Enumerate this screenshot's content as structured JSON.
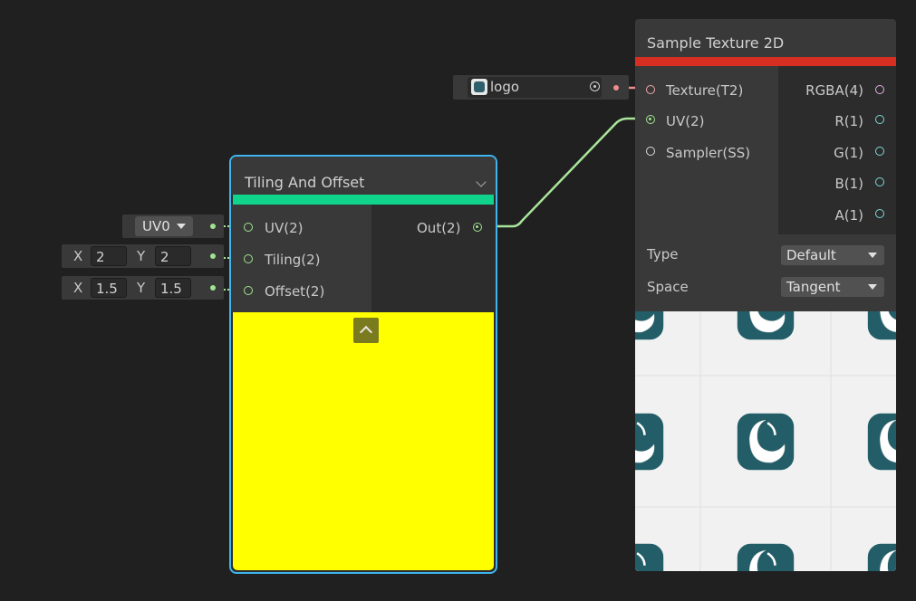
{
  "tiling_node": {
    "title": "Tiling And Offset",
    "inputs": [
      "UV(2)",
      "Tiling(2)",
      "Offset(2)"
    ],
    "output": "Out(2)",
    "accent_color": "#10d38c",
    "preview_color": "#ffff00"
  },
  "uv_field": {
    "value": "UV0"
  },
  "tiling_field": {
    "x_label": "X",
    "x_value": "2",
    "y_label": "Y",
    "y_value": "2"
  },
  "offset_field": {
    "x_label": "X",
    "x_value": "1.5",
    "y_label": "Y",
    "y_value": "1.5"
  },
  "texture_field": {
    "name": "logo"
  },
  "sample_node": {
    "title": "Sample Texture 2D",
    "accent_color": "#d72e23",
    "inputs": [
      "Texture(T2)",
      "UV(2)",
      "Sampler(SS)"
    ],
    "outputs": [
      "RGBA(4)",
      "R(1)",
      "G(1)",
      "B(1)",
      "A(1)"
    ],
    "type_label": "Type",
    "type_value": "Default",
    "space_label": "Space",
    "space_value": "Tangent"
  }
}
